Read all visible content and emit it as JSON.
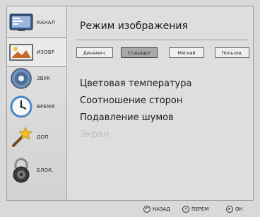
{
  "sidebar": {
    "items": [
      {
        "key": "channel",
        "label": "КАНАЛ",
        "icon": "tv-screen-icon",
        "active": false
      },
      {
        "key": "picture",
        "label": "ИЗОБР",
        "icon": "picture-icon",
        "active": true
      },
      {
        "key": "sound",
        "label": "ЗВУК",
        "icon": "speaker-icon",
        "active": false
      },
      {
        "key": "time",
        "label": "ВРЕМЯ",
        "icon": "clock-icon",
        "active": false
      },
      {
        "key": "extra",
        "label": "ДОП.",
        "icon": "magic-wand-icon",
        "active": false
      },
      {
        "key": "lock",
        "label": "БЛОК.",
        "icon": "padlock-icon",
        "active": false
      }
    ]
  },
  "main": {
    "title": "Режим изображения",
    "modes": [
      {
        "label": "Динамич.",
        "selected": false
      },
      {
        "label": "Стандарт",
        "selected": true
      },
      {
        "label": "Мягкий",
        "selected": false
      },
      {
        "label": "Пользов.",
        "selected": false
      }
    ],
    "menu": [
      {
        "label": "Цветовая температура",
        "enabled": true
      },
      {
        "label": "Соотношение сторон",
        "enabled": true
      },
      {
        "label": "Подавление шумов",
        "enabled": true
      },
      {
        "label": "Экран",
        "enabled": false
      }
    ]
  },
  "footer": {
    "hints": [
      {
        "icon": "back-arrow-icon",
        "glyph": "↶",
        "label": "НАЗАД"
      },
      {
        "icon": "cross-pad-icon",
        "glyph": "+",
        "label": "ПЕРЕМ"
      },
      {
        "icon": "right-arrow-icon",
        "glyph": "▸",
        "label": "ОК"
      }
    ]
  }
}
